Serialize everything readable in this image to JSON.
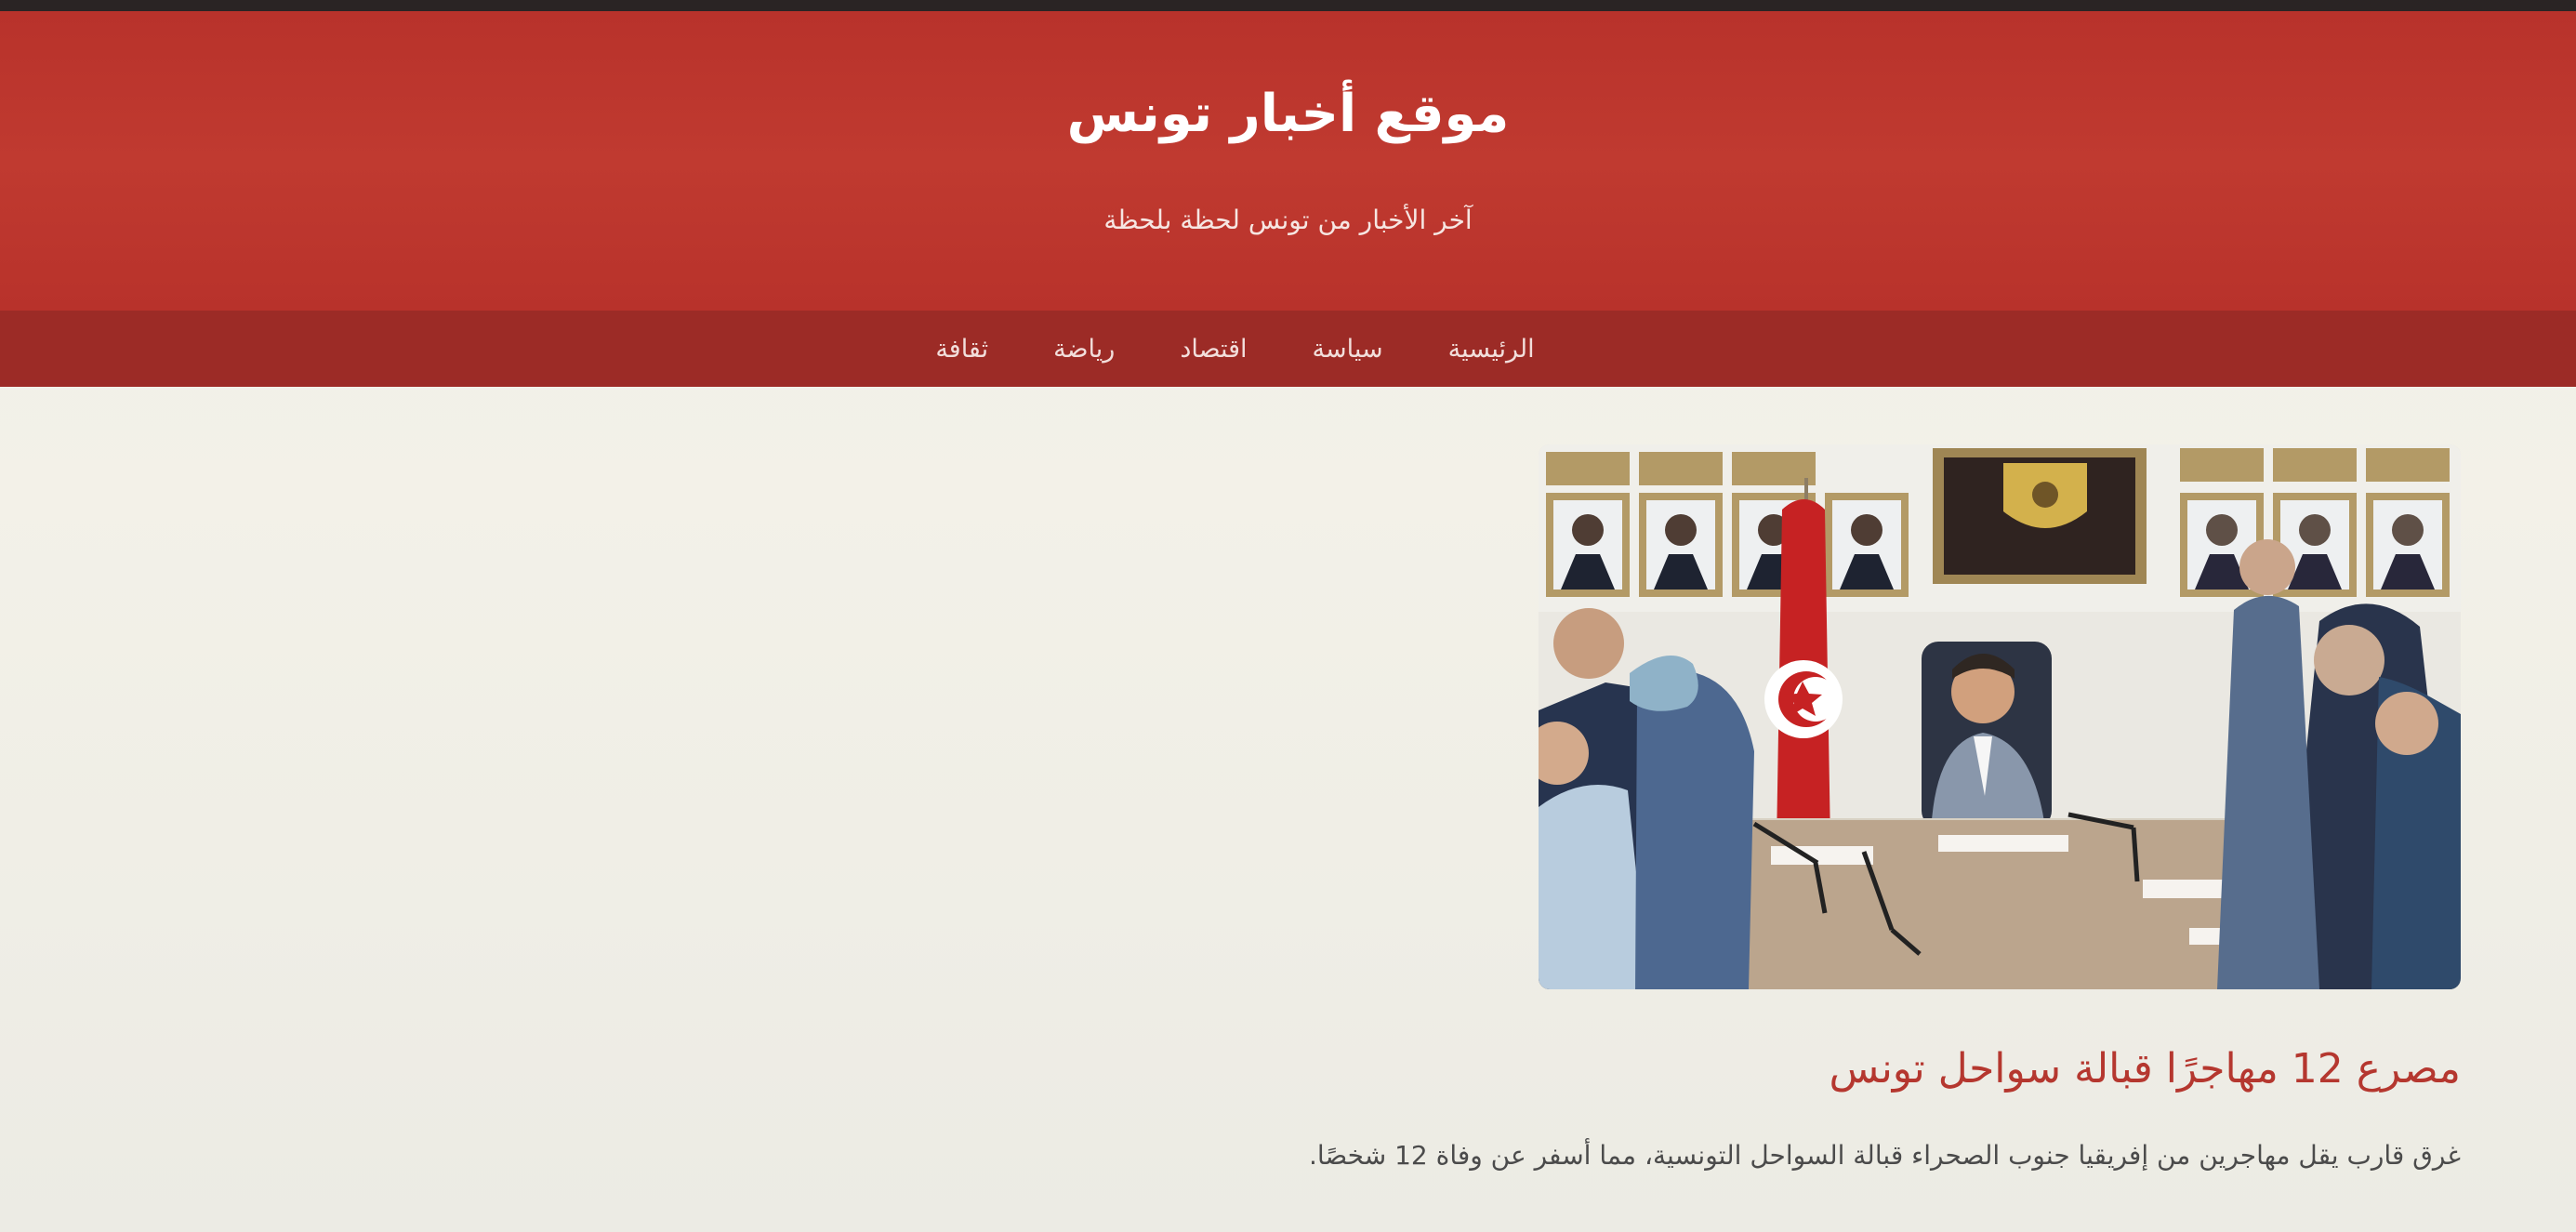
{
  "site": {
    "title": "موقع أخبار تونس",
    "tagline": "آخر الأخبار من تونس لحظة بلحظة"
  },
  "nav": {
    "items": [
      {
        "label": "الرئيسية"
      },
      {
        "label": "سياسة"
      },
      {
        "label": "اقتصاد"
      },
      {
        "label": "رياضة"
      },
      {
        "label": "ثقافة"
      }
    ]
  },
  "article": {
    "image_alt": "meeting-photo",
    "title": "مصرع 12 مهاجرًا قبالة سواحل تونس",
    "excerpt": "غرق قارب يقل مهاجرين من إفريقيا جنوب الصحراء قبالة السواحل التونسية، مما أسفر عن وفاة 12 شخصًا."
  },
  "colors": {
    "header": "#c03a30",
    "nav": "#9c2b26",
    "title_accent": "#b5372f",
    "background": "#efefe8"
  }
}
